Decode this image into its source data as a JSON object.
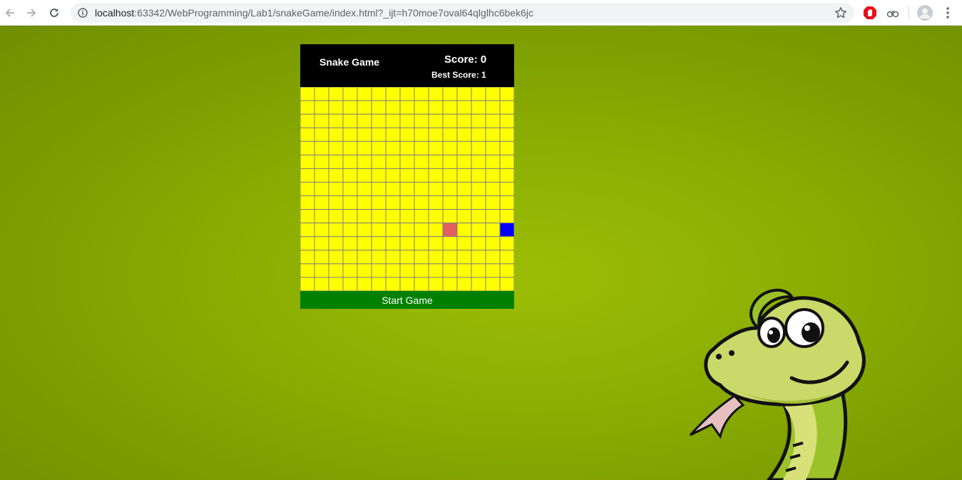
{
  "browser": {
    "url_host": "localhost",
    "url_rest": ":63342/WebProgramming/Lab1/snakeGame/index.html?_ijt=h70moe7oval64qlglhc6bek6jc"
  },
  "game": {
    "title": "Snake Game",
    "score_label": "Score: 0",
    "best_score_label": "Best Score: 1",
    "start_button": "Start Game",
    "grid": {
      "columns": 15,
      "rows": 15
    },
    "snake_cell": {
      "col": 14,
      "row": 10,
      "color": "#0000ff"
    },
    "food_cell": {
      "col": 10,
      "row": 10,
      "color": "#e06060"
    },
    "board_color": "#ffff00",
    "grid_line_color": "#808080"
  },
  "colors": {
    "background": "#8daf02",
    "header": "#000000",
    "start_button": "#008000"
  },
  "icons": [
    "back-icon",
    "forward-icon",
    "reload-icon",
    "info-icon",
    "star-icon",
    "adblock-icon",
    "extension-icon",
    "avatar-icon",
    "menu-icon",
    "snake-mascot"
  ]
}
